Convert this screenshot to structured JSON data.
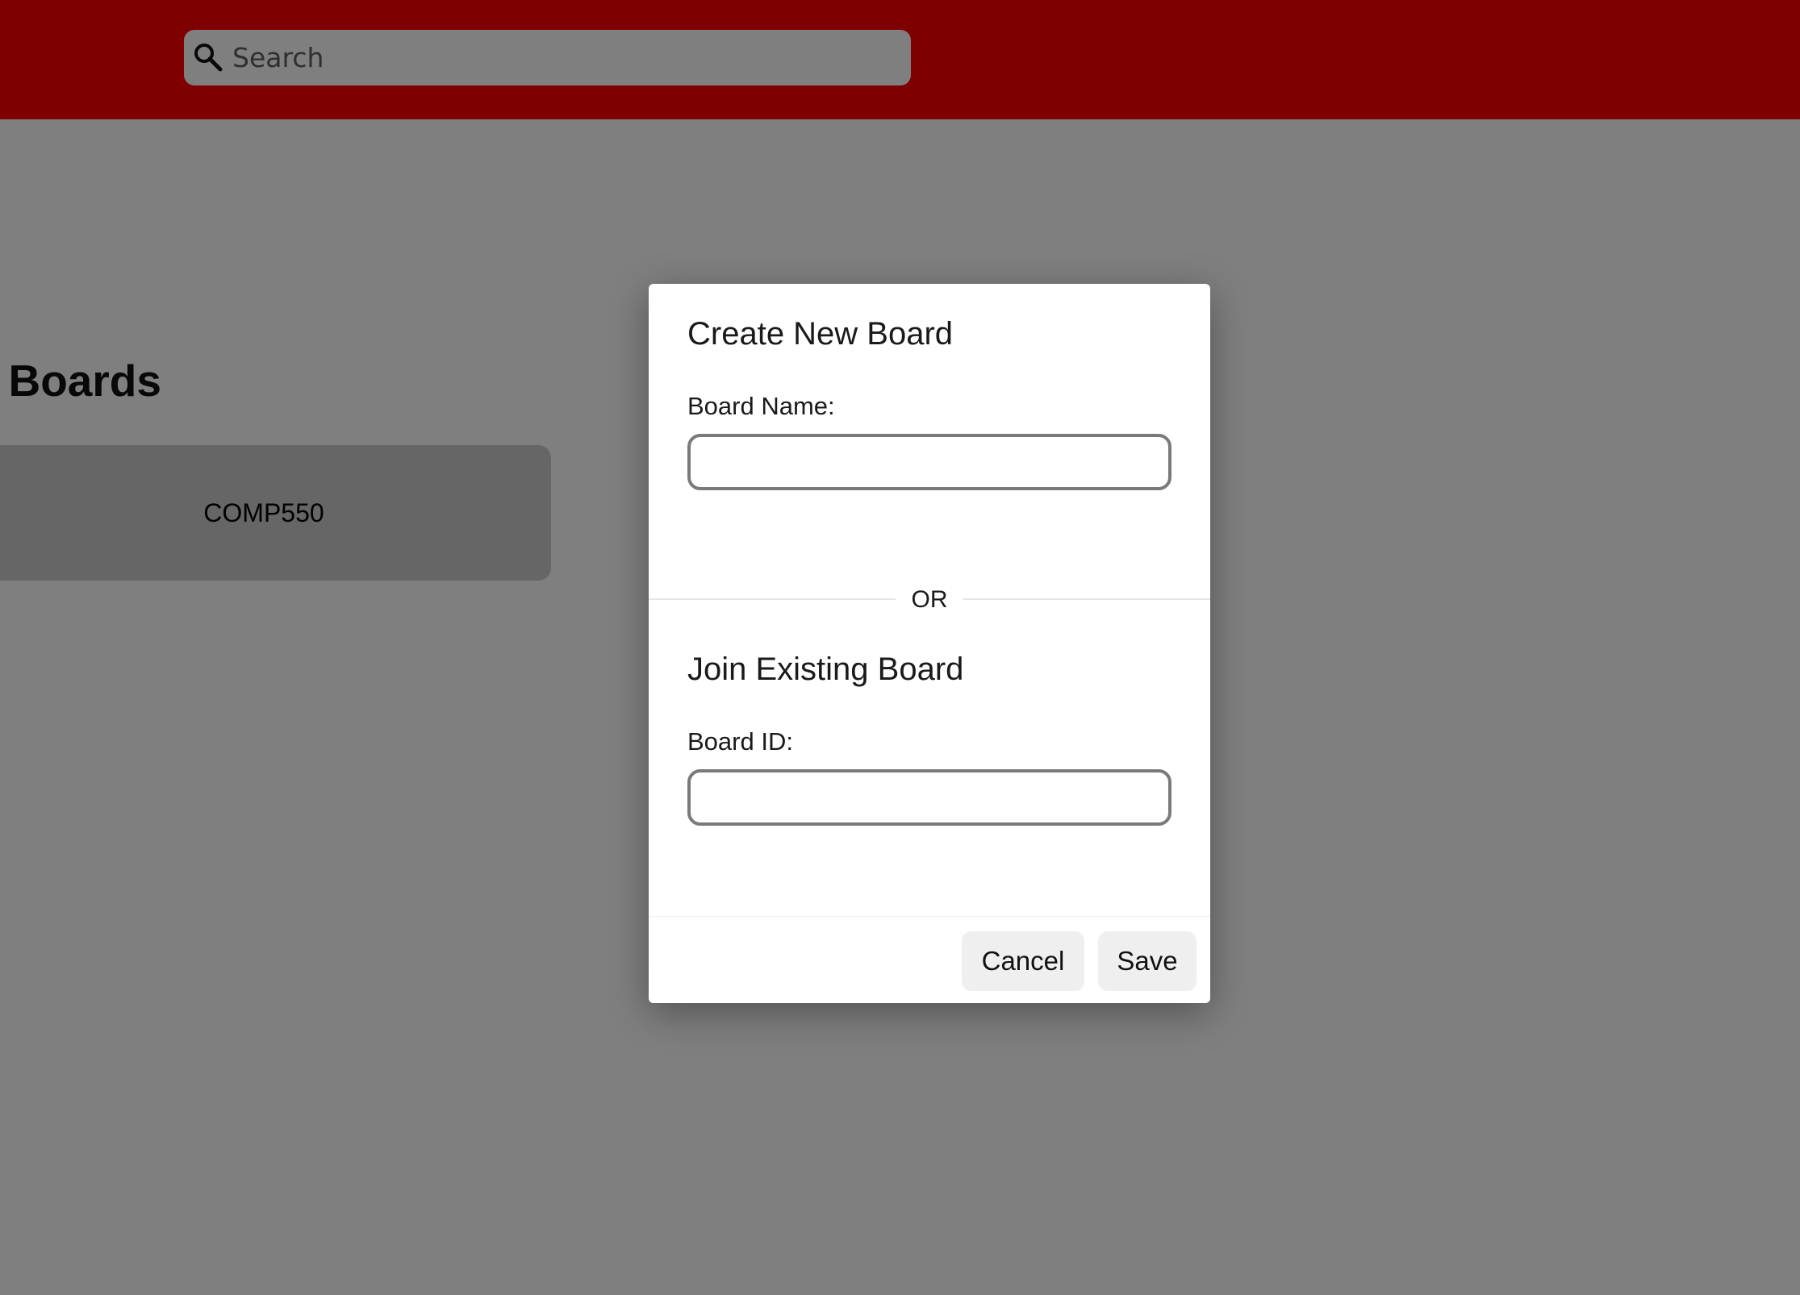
{
  "header": {
    "search": {
      "placeholder": "Search",
      "icon": "search-icon"
    }
  },
  "main": {
    "section_title": "e Boards",
    "boards": [
      {
        "label": "COMP550"
      }
    ]
  },
  "modal": {
    "create_heading": "Create New Board",
    "board_name_label": "Board Name:",
    "board_name_value": "",
    "separator": "OR",
    "join_heading": "Join Existing Board",
    "board_id_label": "Board ID:",
    "board_id_value": "",
    "cancel_label": "Cancel",
    "save_label": "Save"
  },
  "colors": {
    "header_bg": "#ff0000",
    "overlay": "rgba(0,0,0,0.5)",
    "card_bg": "#cccccc",
    "button_bg": "#efefef"
  }
}
